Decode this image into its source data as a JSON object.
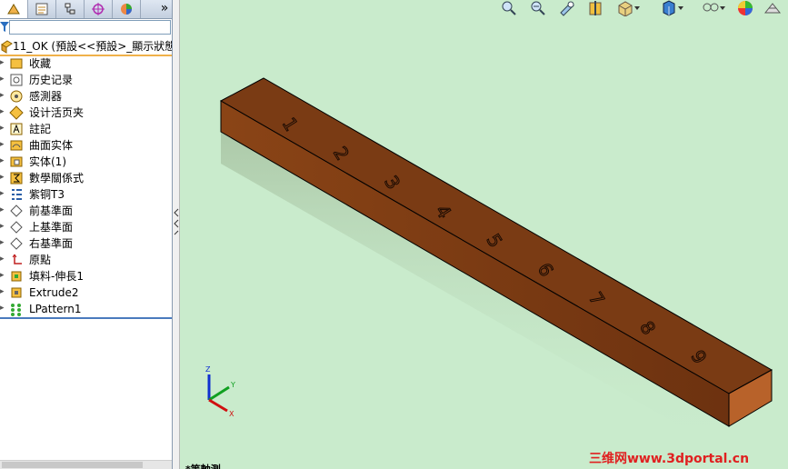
{
  "tabs": [
    {
      "name": "feature-manager",
      "active": true
    },
    {
      "name": "property-manager",
      "active": false
    },
    {
      "name": "configuration-manager",
      "active": false
    },
    {
      "name": "dimxpert-manager",
      "active": false
    },
    {
      "name": "display-manager",
      "active": false
    }
  ],
  "tab_more": "»",
  "root": {
    "label": "11_OK  (預設<<預設>_顯示狀態"
  },
  "tree": [
    {
      "label": "收藏",
      "icon": "favorites-icon"
    },
    {
      "label": "历史记录",
      "icon": "history-icon"
    },
    {
      "label": "感測器",
      "icon": "sensors-icon"
    },
    {
      "label": "设计活页夹",
      "icon": "design-binder-icon"
    },
    {
      "label": "註記",
      "icon": "annotations-icon"
    },
    {
      "label": "曲面实体",
      "icon": "surface-bodies-icon"
    },
    {
      "label": "实体(1)",
      "icon": "solid-bodies-icon"
    },
    {
      "label": "數學關係式",
      "icon": "equations-icon"
    },
    {
      "label": "紫铜T3",
      "icon": "material-icon"
    },
    {
      "label": "前基準面",
      "icon": "plane-icon"
    },
    {
      "label": "上基準面",
      "icon": "plane-icon"
    },
    {
      "label": "右基準面",
      "icon": "plane-icon"
    },
    {
      "label": "原點",
      "icon": "origin-icon"
    },
    {
      "label": "填料-伸長1",
      "icon": "boss-extrude-icon"
    },
    {
      "label": "Extrude2",
      "icon": "extrude-icon"
    },
    {
      "label": "LPattern1",
      "icon": "linear-pattern-icon"
    }
  ],
  "bar_numbers": [
    "1",
    "2",
    "3",
    "4",
    "5",
    "6",
    "7",
    "8",
    "9"
  ],
  "triad": {
    "z": "Z",
    "y": "Y",
    "x": "X"
  },
  "view_label": "*等軸測",
  "watermark": "三维网www.3dportal.cn",
  "colors": {
    "viewport": "#c9ebcc",
    "bar_top": "#7a3b14",
    "bar_front": "#7b3a12",
    "bar_end": "#b8622a",
    "accent": "#f0b14a"
  }
}
